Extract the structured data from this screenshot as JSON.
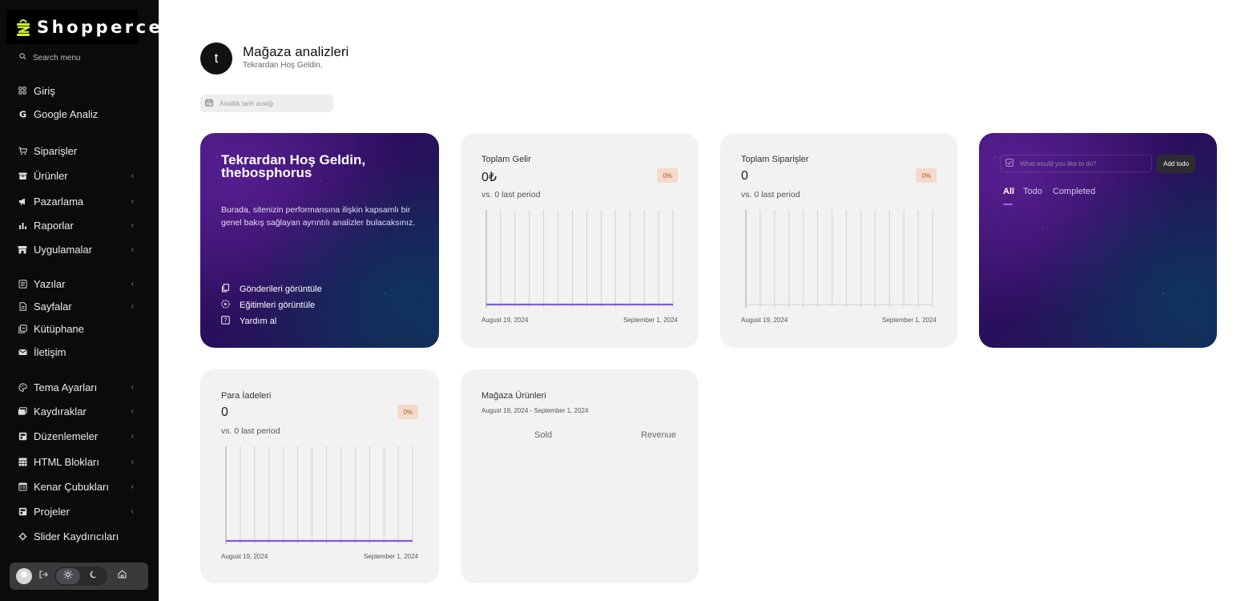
{
  "brand": {
    "name": "Shopperce",
    "accent": "#d4f021"
  },
  "sidebar": {
    "search_placeholder": "Search menu",
    "items": [
      {
        "label": "Giriş",
        "icon": "grid-icon",
        "chevron": ""
      },
      {
        "label": "Google Analiz",
        "icon": "google-icon",
        "chevron": ""
      },
      {
        "label": "Siparişler",
        "icon": "cart-icon",
        "chevron": ""
      },
      {
        "label": "Ürünler",
        "icon": "box-icon",
        "chevron": "‹"
      },
      {
        "label": "Pazarlama",
        "icon": "megaphone-icon",
        "chevron": "‹"
      },
      {
        "label": "Raporlar",
        "icon": "bar-chart-icon",
        "chevron": "‹"
      },
      {
        "label": "Uygulamalar",
        "icon": "store-icon",
        "chevron": "‹"
      },
      {
        "label": "Yazılar",
        "icon": "article-icon",
        "chevron": "‹"
      },
      {
        "label": "Sayfalar",
        "icon": "page-icon",
        "chevron": "‹"
      },
      {
        "label": "Kütüphane",
        "icon": "library-icon",
        "chevron": ""
      },
      {
        "label": "İletişim",
        "icon": "mail-icon",
        "chevron": ""
      },
      {
        "label": "Tema Ayarları",
        "icon": "palette-icon",
        "chevron": "‹"
      },
      {
        "label": "Kaydıraklar",
        "icon": "slides-icon",
        "chevron": "‹"
      },
      {
        "label": "Düzenlemeler",
        "icon": "layout-icon",
        "chevron": "‹"
      },
      {
        "label": "HTML Blokları",
        "icon": "blocks-icon",
        "chevron": "‹"
      },
      {
        "label": "Kenar Çubukları",
        "icon": "sidebar-icon",
        "chevron": "‹"
      },
      {
        "label": "Projeler",
        "icon": "projects-icon",
        "chevron": "‹"
      },
      {
        "label": "Slider Kaydırıcıları",
        "icon": "slider-icon",
        "chevron": ""
      }
    ]
  },
  "header": {
    "avatar_letter": "t",
    "title": "Mağaza analizleri",
    "subtitle": "Tekrardan Hoş Geldin,",
    "date_range_placeholder": "Analitik tarih aralığı"
  },
  "welcome": {
    "title": "Tekrardan Hoş Geldin, thebosphorus",
    "description": "Burada, sitenizin performansına ilişkin kapsamlı bir genel bakış sağlayan ayrıntılı analizler bulacaksınız.",
    "links": [
      "Gönderileri görüntüle",
      "Eğitimleri görüntüle",
      "Yardım al"
    ]
  },
  "stats": [
    {
      "label": "Toplam Gelir",
      "value": "0₺",
      "badge": "0%",
      "compare": "vs. 0 last period",
      "date_start": "August 19, 2024",
      "date_end": "September 1, 2024",
      "line_color": "#7b5ce0",
      "line_value": 0
    },
    {
      "label": "Toplam Siparişler",
      "value": "0",
      "badge": "0%",
      "compare": "vs. 0 last period",
      "date_start": "August 19, 2024",
      "date_end": "September 1, 2024",
      "line_color": "",
      "line_value": 0
    },
    {
      "label": "Para İadeleri",
      "value": "0",
      "badge": "0%",
      "compare": "vs. 0 last period",
      "date_start": "August 19, 2024",
      "date_end": "September 1, 2024",
      "line_color": "#7b5ce0",
      "line_value": 0
    }
  ],
  "todo": {
    "placeholder": "What would you like to do?",
    "add_label": "Add todo",
    "tabs": [
      "All",
      "Todo",
      "Completed"
    ],
    "active_tab": "All"
  },
  "products": {
    "title": "Mağaza Ürünleri",
    "range": "August 19, 2024 - September 1, 2024",
    "columns": [
      "Sold",
      "Revenue"
    ]
  }
}
